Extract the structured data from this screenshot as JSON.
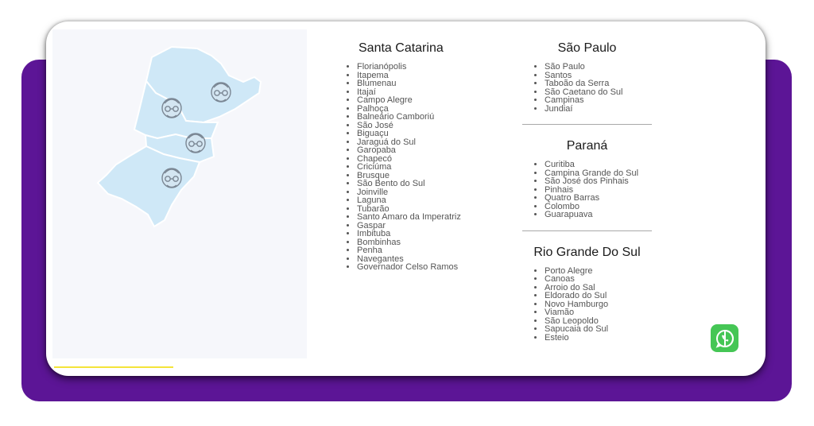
{
  "regions": [
    {
      "title": "Santa Catarina",
      "cities": [
        "Florianópolis",
        "Itapema",
        "Blumenau",
        "Itajaí",
        "Campo Alegre",
        "Palhoça",
        "Balneário Camboriú",
        "São José",
        "Biguaçu",
        "Jaraguá do Sul",
        "Garopaba",
        "Chapecó",
        "Criciúma",
        "Brusque",
        "São Bento do Sul",
        "Joinville",
        "Laguna",
        "Tubarão",
        "Santo Amaro da Imperatriz",
        "Gaspar",
        "Imbituba",
        "Bombinhas",
        "Penha",
        "Navegantes",
        "Governador Celso Ramos"
      ]
    },
    {
      "title": "São Paulo",
      "cities": [
        "São Paulo",
        "Santos",
        "Taboão da Serra",
        "São Caetano do Sul",
        "Campinas",
        "Jundiaí"
      ]
    },
    {
      "title": "Paraná",
      "cities": [
        "Curitiba",
        "Campina Grande do Sul",
        "São José dos Pinhais",
        "Pinhais",
        "Quatro Barras",
        "Colombo",
        "Guarapuava"
      ]
    },
    {
      "title": "Rio Grande Do Sul",
      "cities": [
        "Porto Alegre",
        "Canoas",
        "Arroio do Sal",
        "Eldorado do Sul",
        "Novo Hamburgo",
        "Viamão",
        "São Leopoldo",
        "Sapucaia do Sul",
        "Esteio"
      ]
    }
  ],
  "map": {
    "state_count": 4,
    "fill_color": "#cfe8f7",
    "icon": "face-icon"
  },
  "colors": {
    "purple": "#5c1596",
    "accent_line": "#f4e43a",
    "whatsapp": "#45c655"
  },
  "whatsapp": {
    "icon": "whatsapp-icon"
  }
}
